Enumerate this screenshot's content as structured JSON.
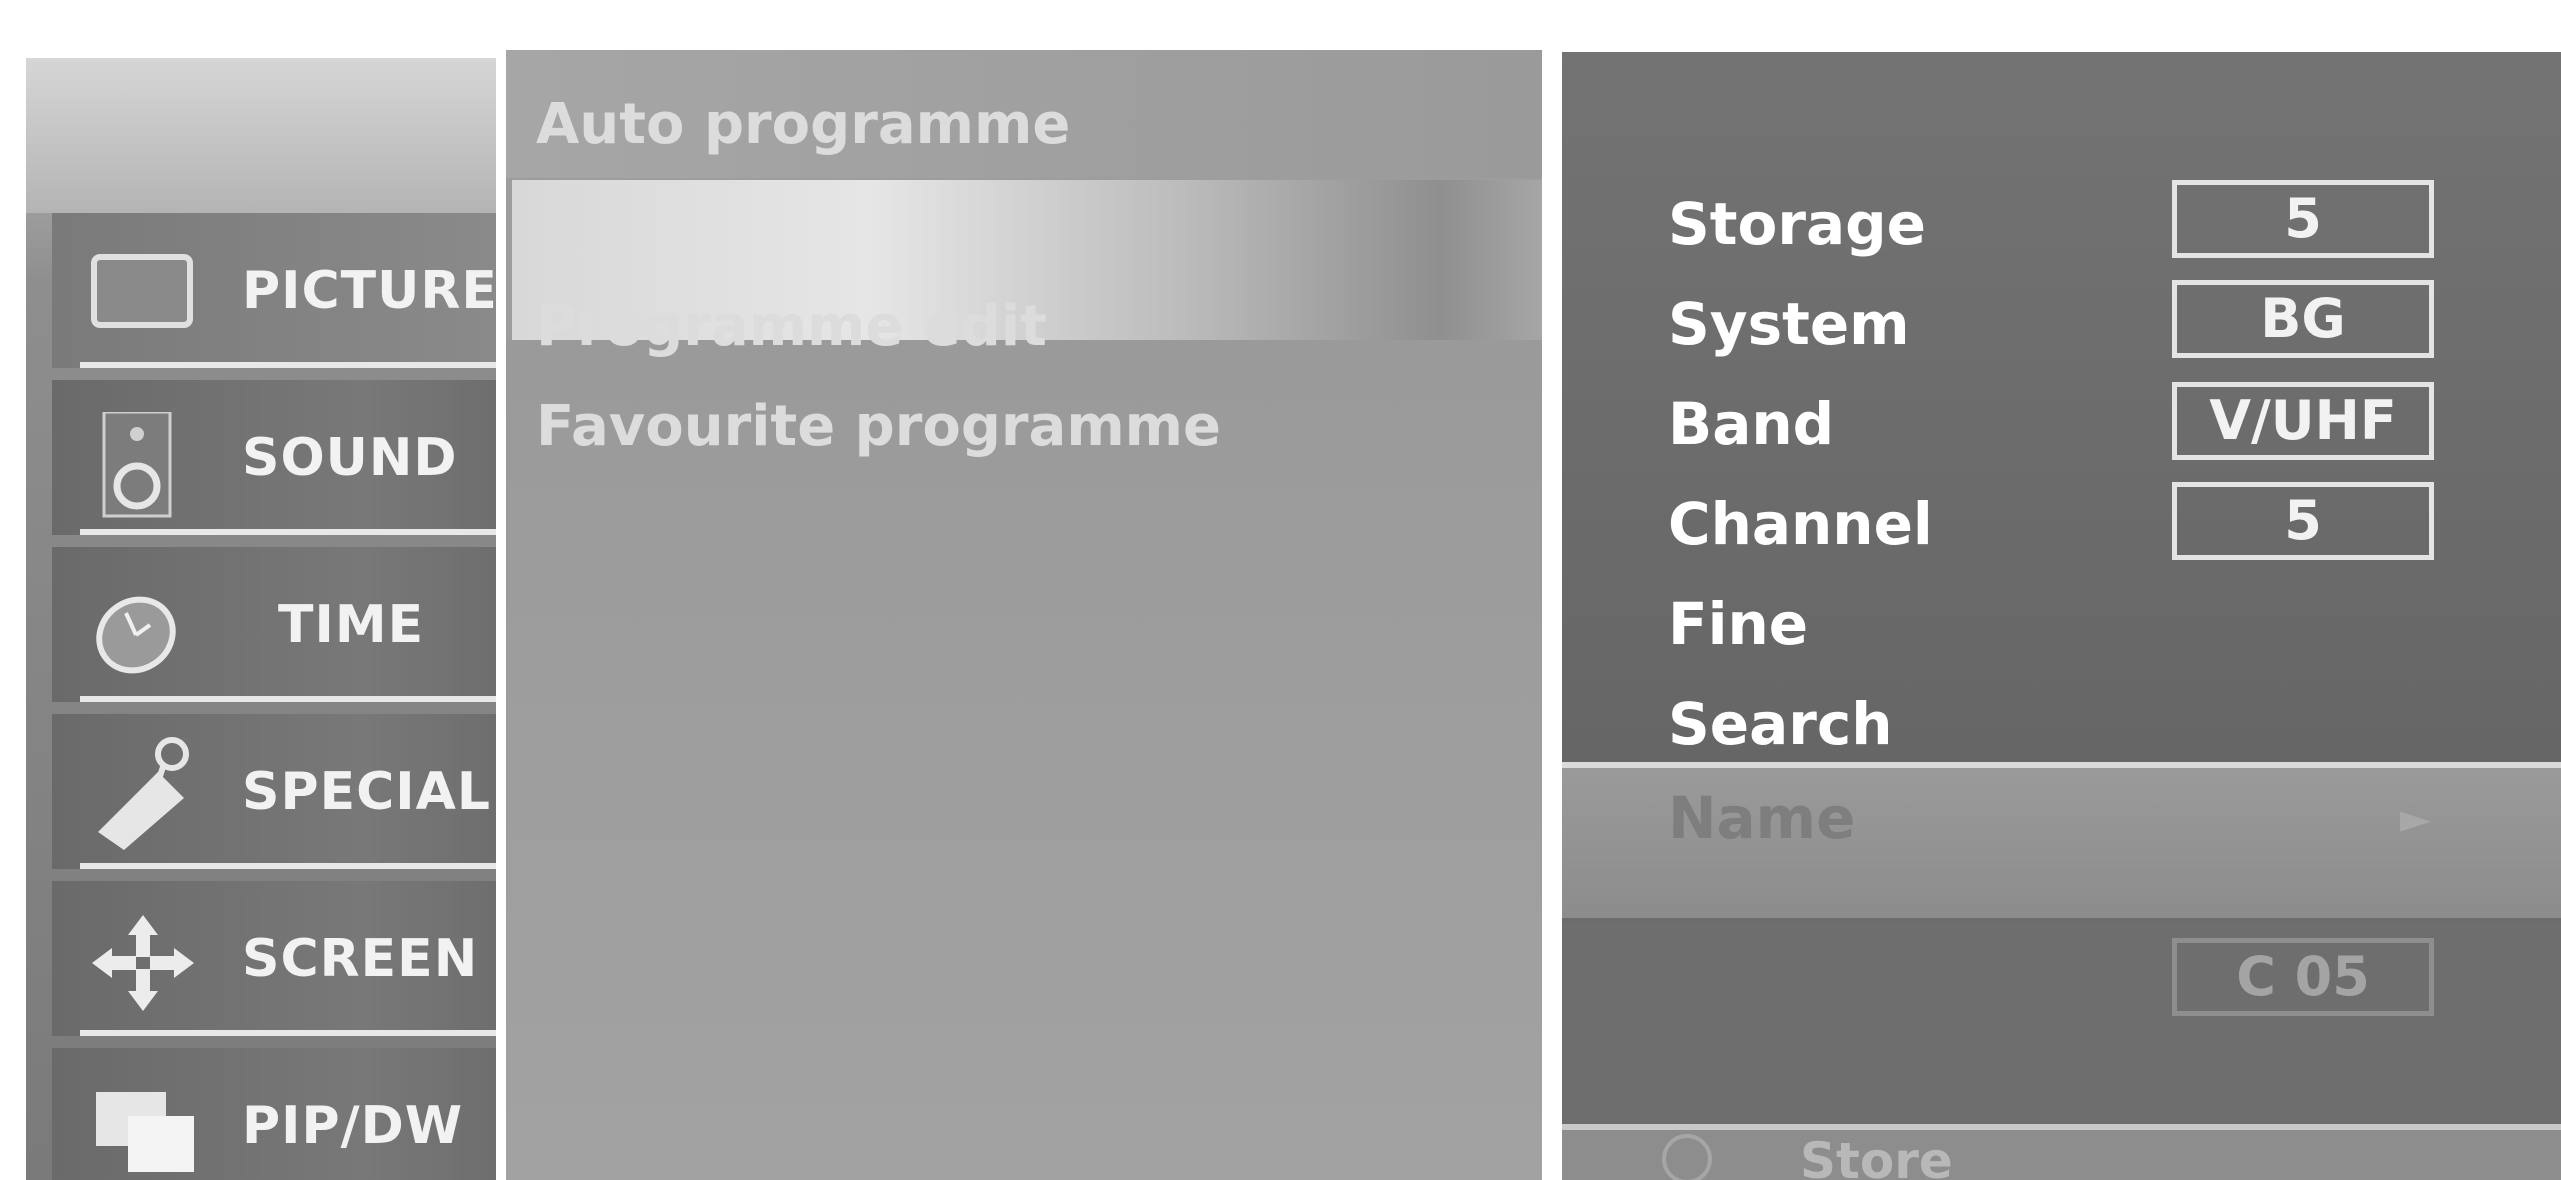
{
  "sidebar": {
    "items": [
      {
        "label": "PICTURE",
        "icon": "picture-icon"
      },
      {
        "label": "SOUND",
        "icon": "speaker-icon"
      },
      {
        "label": "TIME",
        "icon": "clock-icon"
      },
      {
        "label": "SPECIAL",
        "icon": "tag-icon"
      },
      {
        "label": "SCREEN",
        "icon": "move-arrows-icon"
      },
      {
        "label": "PIP/DW",
        "icon": "pip-icon"
      }
    ]
  },
  "menu": {
    "items": [
      {
        "label": "Auto programme"
      },
      {
        "label": ""
      },
      {
        "label": "Programme edit"
      },
      {
        "label": "Favourite programme"
      }
    ]
  },
  "settings": {
    "storage": {
      "label": "Storage",
      "value": "5"
    },
    "system": {
      "label": "System",
      "value": "BG"
    },
    "band": {
      "label": "Band",
      "value": "V/UHF"
    },
    "channel": {
      "label": "Channel",
      "value": "5"
    },
    "fine": {
      "label": "Fine"
    },
    "search": {
      "label": "Search"
    },
    "name": {
      "label": "Name",
      "arrow": "►",
      "value": "C 05"
    },
    "store": {
      "label": "Store"
    }
  },
  "colors": {
    "panel": "#6c6c6c",
    "menu": "#9d9d9d",
    "text_bright": "#ffffff",
    "text_dim": "#dcdcdc"
  }
}
